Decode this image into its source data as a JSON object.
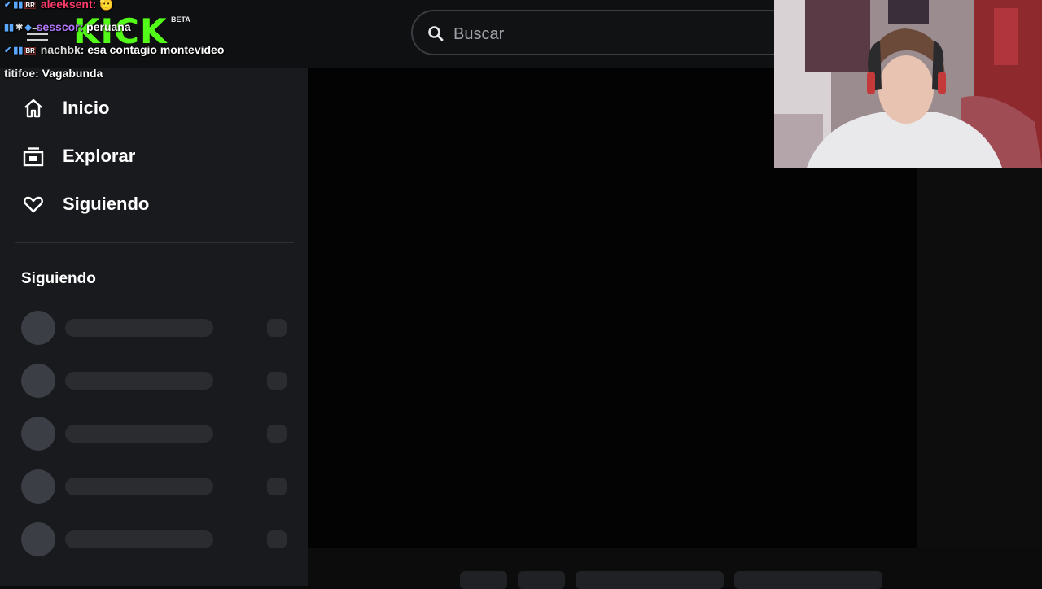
{
  "header": {
    "logo_text": "KICK",
    "beta_label": "BETA",
    "search_placeholder": "Buscar"
  },
  "sidebar": {
    "nav": [
      {
        "label": "Inicio",
        "icon": "home-icon"
      },
      {
        "label": "Explorar",
        "icon": "browse-icon"
      },
      {
        "label": "Siguiendo",
        "icon": "heart-icon"
      }
    ],
    "section_title": "Siguiendo",
    "loading_rows": 5
  },
  "chat": [
    {
      "user": "aleeksent:",
      "user_color": "#ff3b6b",
      "message": "🫡"
    },
    {
      "user": "sesscor:",
      "user_color": "#b477ff",
      "message": "peruana"
    },
    {
      "user": "nachbk:",
      "user_color": "#d9d9d9",
      "message": "esa contagio montevideo"
    },
    {
      "user": "titifoe:",
      "user_color": "#e9e9e9",
      "message": "Vagabunda"
    }
  ],
  "colors": {
    "brand": "#53fc18",
    "sidebar_bg": "#191a1d",
    "skeleton": "#3b3e44"
  }
}
